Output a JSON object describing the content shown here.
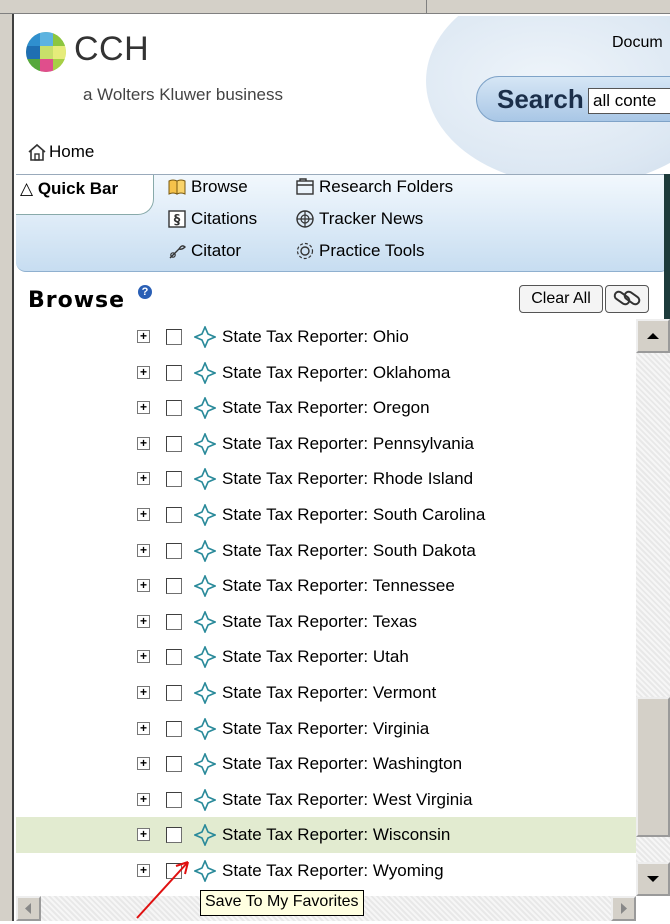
{
  "header": {
    "brand": "CCH",
    "tagline": "a Wolters Kluwer business",
    "top_right_text": "Docum",
    "search_label": "Search",
    "search_value": "all conte",
    "home_label": "Home"
  },
  "quickbar": {
    "tab_label": "Quick Bar",
    "items": [
      {
        "label": "Browse",
        "icon": "book-icon"
      },
      {
        "label": "Research Folders",
        "icon": "folder-icon"
      },
      {
        "label": "Citations",
        "icon": "citation-icon"
      },
      {
        "label": "Tracker News",
        "icon": "globe-icon"
      },
      {
        "label": "Citator",
        "icon": "citator-icon"
      },
      {
        "label": "Practice Tools",
        "icon": "gear-icon"
      }
    ]
  },
  "browse": {
    "title": "Browse",
    "help": "?",
    "clear_all_label": "Clear All",
    "items": [
      "State Tax Reporter: Ohio",
      "State Tax Reporter: Oklahoma",
      "State Tax Reporter: Oregon",
      "State Tax Reporter: Pennsylvania",
      "State Tax Reporter: Rhode Island",
      "State Tax Reporter: South Carolina",
      "State Tax Reporter: South Dakota",
      "State Tax Reporter: Tennessee",
      "State Tax Reporter: Texas",
      "State Tax Reporter: Utah",
      "State Tax Reporter: Vermont",
      "State Tax Reporter: Virginia",
      "State Tax Reporter: Washington",
      "State Tax Reporter: West Virginia",
      "State Tax Reporter: Wisconsin",
      "State Tax Reporter: Wyoming"
    ],
    "highlighted_item": "State Tax Reporter: Wisconsin"
  },
  "tooltip": {
    "text": "Save To My Favorites"
  },
  "colors": {
    "highlight_row": "#e2ebd0",
    "annotation_arrow": "#e01010",
    "quickbar_bg": "#c7ddf1",
    "tooltip_bg": "#ffffe1"
  }
}
